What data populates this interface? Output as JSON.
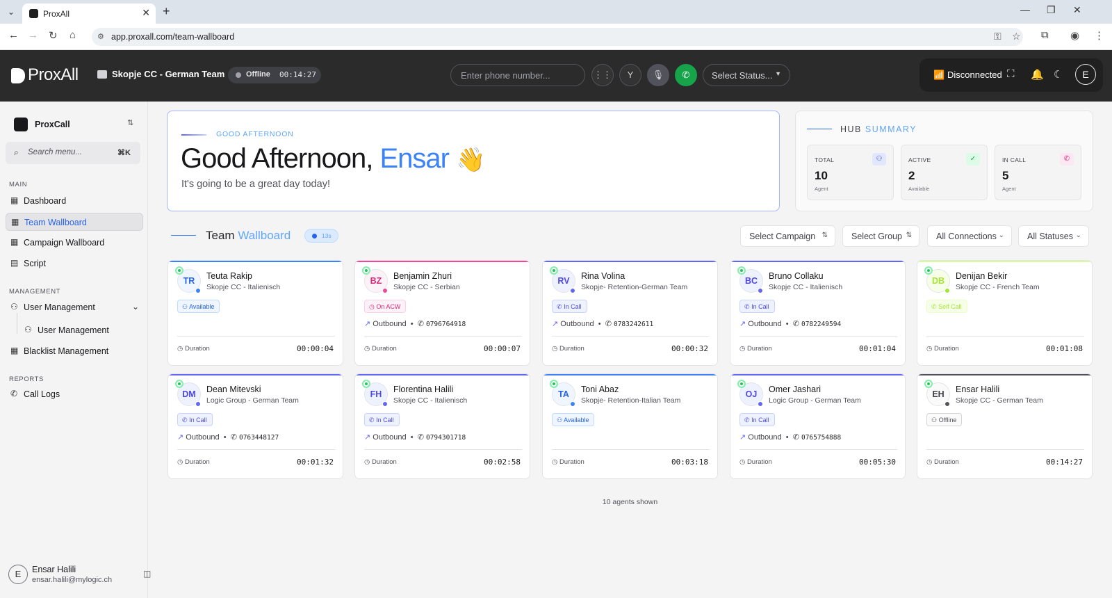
{
  "browser": {
    "tab_title": "ProxAll",
    "url": "app.proxall.com/team-wallboard"
  },
  "header": {
    "logo": "ProxAll",
    "team": "Skopje CC - German Team",
    "status_label": "Offline",
    "status_timer": "00:14:27",
    "phone_placeholder": "Enter phone number...",
    "select_status": "Select Status...",
    "connection": "Disconnected",
    "user_initial": "E",
    "colors": {
      "header_bg": "#2b2b2b",
      "disconnected": "#ef4444",
      "call_button": "#16a34a"
    }
  },
  "sidebar": {
    "org": "ProxCall",
    "search_placeholder": "Search menu...",
    "search_shortcut": "⌘K",
    "sections": {
      "main": "MAIN",
      "management": "MANAGEMENT",
      "reports": "REPORTS"
    },
    "items": {
      "dashboard": "Dashboard",
      "team_wallboard": "Team Wallboard",
      "campaign_wallboard": "Campaign Wallboard",
      "script": "Script",
      "user_management": "User Management",
      "user_management_sub": "User Management",
      "blacklist_management": "Blacklist Management",
      "call_logs": "Call Logs"
    },
    "user": {
      "initial": "E",
      "name": "Ensar Halili",
      "email": "ensar.halili@mylogic.ch"
    }
  },
  "greeting": {
    "kicker": "GOOD AFTERNOON",
    "title_prefix": "Good Afternoon, ",
    "title_name": "Ensar",
    "emoji": "👋",
    "subtitle": "It's going to be a great day today!"
  },
  "hub": {
    "title_a": "HUB",
    "title_b": "SUMMARY",
    "cards": [
      {
        "label": "TOTAL",
        "value": "10",
        "sub": "Agent",
        "icon": "users-icon"
      },
      {
        "label": "ACTIVE",
        "value": "2",
        "sub": "Available",
        "icon": "check-icon"
      },
      {
        "label": "IN CALL",
        "value": "5",
        "sub": "Agent",
        "icon": "phone-icon"
      }
    ]
  },
  "wallboard": {
    "title_a": "Team",
    "title_b": "Wallboard",
    "refresh": "13s",
    "filters": {
      "campaign": "Select Campaign",
      "group": "Select Group",
      "connections": "All Connections",
      "statuses": "All Statuses"
    },
    "duration_label": "Duration",
    "footer": "10 agents shown"
  },
  "agents": [
    {
      "initials": "TR",
      "name": "Teuta Rakip",
      "team": "Skopje CC - Italienisch",
      "status": "Available",
      "status_key": "available",
      "direction": "",
      "phone": "",
      "duration": "00:00:04",
      "accent": "#3b82f6"
    },
    {
      "initials": "BZ",
      "name": "Benjamin Zhuri",
      "team": "Skopje CC - Serbian",
      "status": "On ACW",
      "status_key": "acw",
      "direction": "Outbound",
      "phone": "0796764918",
      "duration": "00:00:07",
      "accent": "#ec4899"
    },
    {
      "initials": "RV",
      "name": "Rina Volina",
      "team": "Skopje- Retention-German Team",
      "status": "In Call",
      "status_key": "incall",
      "direction": "Outbound",
      "phone": "0783242611",
      "duration": "00:00:32",
      "accent": "#6366f1"
    },
    {
      "initials": "BC",
      "name": "Bruno Collaku",
      "team": "Skopje CC - Italienisch",
      "status": "In Call",
      "status_key": "incall",
      "direction": "Outbound",
      "phone": "0782249594",
      "duration": "00:01:04",
      "accent": "#6366f1"
    },
    {
      "initials": "DB",
      "name": "Denijan Bekir",
      "team": "Skopje CC - French Team",
      "status": "Self Call",
      "status_key": "selfcall",
      "direction": "",
      "phone": "",
      "duration": "00:01:08",
      "accent": "#d9f99d"
    },
    {
      "initials": "DM",
      "name": "Dean Mitevski",
      "team": "Logic Group - German Team",
      "status": "In Call",
      "status_key": "incall",
      "direction": "Outbound",
      "phone": "0763448127",
      "duration": "00:01:32",
      "accent": "#6366f1"
    },
    {
      "initials": "FH",
      "name": "Florentina Halili",
      "team": "Skopje CC - Italienisch",
      "status": "In Call",
      "status_key": "incall",
      "direction": "Outbound",
      "phone": "0794301718",
      "duration": "00:02:58",
      "accent": "#6366f1"
    },
    {
      "initials": "TA",
      "name": "Toni Abaz",
      "team": "Skopje- Retention-Italian Team",
      "status": "Available",
      "status_key": "available",
      "direction": "",
      "phone": "",
      "duration": "00:03:18",
      "accent": "#3b82f6"
    },
    {
      "initials": "OJ",
      "name": "Omer Jashari",
      "team": "Logic Group - German Team",
      "status": "In Call",
      "status_key": "incall",
      "direction": "Outbound",
      "phone": "0765754888",
      "duration": "00:05:30",
      "accent": "#6366f1"
    },
    {
      "initials": "EH",
      "name": "Ensar Halili",
      "team": "Skopje CC - German Team",
      "status": "Offline",
      "status_key": "offline",
      "direction": "",
      "phone": "",
      "duration": "00:14:27",
      "accent": "#52525b"
    }
  ]
}
